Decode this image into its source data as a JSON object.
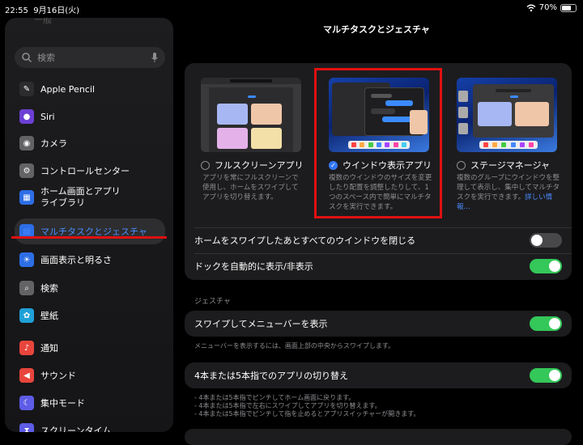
{
  "status": {
    "time": "22:55",
    "date": "9月16日(火)",
    "battery": "70%",
    "battery_level": 0.7
  },
  "sidebar": {
    "ghost_item": "一般",
    "search_placeholder": "検索",
    "items": [
      {
        "label": "Apple Pencil",
        "icon": "pencil-icon",
        "color": "#2c2c2e"
      },
      {
        "label": "Siri",
        "icon": "siri-icon",
        "color": "#6b3fd4"
      },
      {
        "label": "カメラ",
        "icon": "camera-icon",
        "color": "#636366"
      },
      {
        "label": "コントロールセンター",
        "icon": "toggles-icon",
        "color": "#636366"
      },
      {
        "label": "ホーム画面とアプリライブラリ",
        "label_line1": "ホーム画面とアプリ",
        "label_line2": "ライブラリ",
        "icon": "home-screen-icon",
        "color": "#2d6ee6"
      },
      {
        "label": "マルチタスクとジェスチャ",
        "icon": "multitask-icon",
        "color": "#2d6ee6",
        "active": true
      },
      {
        "label": "画面表示と明るさ",
        "icon": "sun-icon",
        "color": "#2d6ee6"
      },
      {
        "label": "検索",
        "icon": "search-icon",
        "color": "#636366"
      },
      {
        "label": "壁紙",
        "icon": "wallpaper-icon",
        "color": "#1fa0d6"
      },
      {
        "label": "通知",
        "icon": "bell-icon",
        "color": "#e8453c"
      },
      {
        "label": "サウンド",
        "icon": "speaker-icon",
        "color": "#e8453c"
      },
      {
        "label": "集中モード",
        "icon": "moon-icon",
        "color": "#5e5ce6"
      },
      {
        "label": "スクリーンタイム",
        "icon": "hourglass-icon",
        "color": "#5e5ce6"
      }
    ]
  },
  "main": {
    "title": "マルチタスクとジェスチャ",
    "modes": [
      {
        "label": "フルスクリーンアプリ",
        "selected": false,
        "desc": "アプリを常にフルスクリーンで使用し、ホームをスワイプしてアプリを切り替えます。"
      },
      {
        "label": "ウインドウ表示アプリ",
        "selected": true,
        "desc": "複数のウインドウのサイズを変更したり配置を調整したりして、1つのスペース内で簡単にマルチタスクを実行できます。"
      },
      {
        "label": "ステージマネージャ",
        "selected": false,
        "desc": "複数のグループにウインドウを整理して表示し、集中してマルチタスクを実行できます。",
        "link": "詳しい情報..."
      }
    ],
    "rows": [
      {
        "label": "ホームをスワイプしたあとすべてのウインドウを閉じる",
        "on": false
      },
      {
        "label": "ドックを自動的に表示/非表示",
        "on": true
      }
    ],
    "gesture_section": "ジェスチャ",
    "gesture_rows": [
      {
        "label": "スワイプしてメニューバーを表示",
        "on": true,
        "note": "メニューバーを表示するには、画面上部の中央からスワイプします。"
      },
      {
        "label": "4本または5本指でのアプリの切り替え",
        "on": true,
        "notes": [
          "- 4本または5本指でピンチしてホーム画面に戻ります。",
          "- 4本または5本指で左右にスワイプしてアプリを切り替えます。",
          "- 4本または5本指でピンチして指を止めるとアプリスイッチャーが開きます。"
        ]
      }
    ]
  }
}
